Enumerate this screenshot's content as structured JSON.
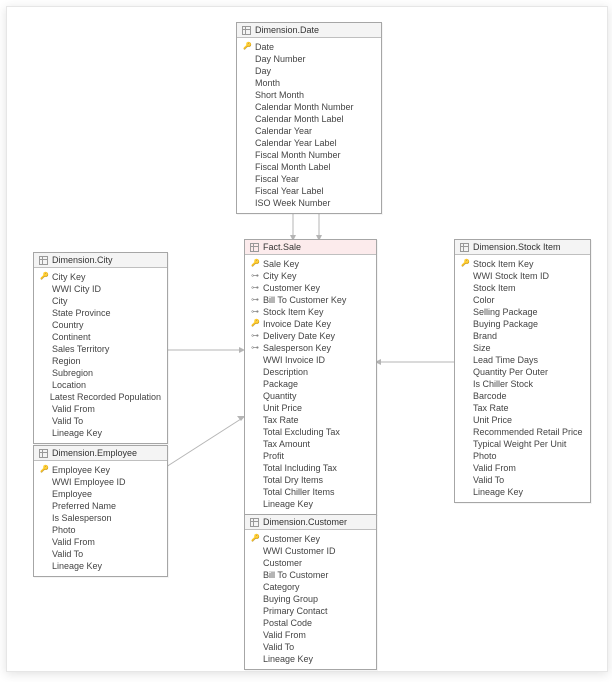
{
  "tables": {
    "date": {
      "title": "Dimension.Date",
      "columns": [
        {
          "name": "Date",
          "kind": "pk"
        },
        {
          "name": "Day Number",
          "kind": ""
        },
        {
          "name": "Day",
          "kind": ""
        },
        {
          "name": "Month",
          "kind": ""
        },
        {
          "name": "Short Month",
          "kind": ""
        },
        {
          "name": "Calendar Month Number",
          "kind": ""
        },
        {
          "name": "Calendar Month Label",
          "kind": ""
        },
        {
          "name": "Calendar Year",
          "kind": ""
        },
        {
          "name": "Calendar Year Label",
          "kind": ""
        },
        {
          "name": "Fiscal Month Number",
          "kind": ""
        },
        {
          "name": "Fiscal Month Label",
          "kind": ""
        },
        {
          "name": "Fiscal Year",
          "kind": ""
        },
        {
          "name": "Fiscal Year Label",
          "kind": ""
        },
        {
          "name": "ISO Week Number",
          "kind": ""
        }
      ]
    },
    "city": {
      "title": "Dimension.City",
      "columns": [
        {
          "name": "City Key",
          "kind": "pk"
        },
        {
          "name": "WWI City ID",
          "kind": ""
        },
        {
          "name": "City",
          "kind": ""
        },
        {
          "name": "State Province",
          "kind": ""
        },
        {
          "name": "Country",
          "kind": ""
        },
        {
          "name": "Continent",
          "kind": ""
        },
        {
          "name": "Sales Territory",
          "kind": ""
        },
        {
          "name": "Region",
          "kind": ""
        },
        {
          "name": "Subregion",
          "kind": ""
        },
        {
          "name": "Location",
          "kind": ""
        },
        {
          "name": "Latest Recorded Population",
          "kind": ""
        },
        {
          "name": "Valid From",
          "kind": ""
        },
        {
          "name": "Valid To",
          "kind": ""
        },
        {
          "name": "Lineage Key",
          "kind": ""
        }
      ]
    },
    "fact": {
      "title": "Fact.Sale",
      "columns": [
        {
          "name": "Sale Key",
          "kind": "pk"
        },
        {
          "name": "City Key",
          "kind": "fk"
        },
        {
          "name": "Customer Key",
          "kind": "fk"
        },
        {
          "name": "Bill To Customer Key",
          "kind": "fk"
        },
        {
          "name": "Stock Item Key",
          "kind": "fk"
        },
        {
          "name": "Invoice Date Key",
          "kind": "pk"
        },
        {
          "name": "Delivery Date Key",
          "kind": "fk"
        },
        {
          "name": "Salesperson Key",
          "kind": "fk"
        },
        {
          "name": "WWI Invoice ID",
          "kind": ""
        },
        {
          "name": "Description",
          "kind": ""
        },
        {
          "name": "Package",
          "kind": ""
        },
        {
          "name": "Quantity",
          "kind": ""
        },
        {
          "name": "Unit Price",
          "kind": ""
        },
        {
          "name": "Tax Rate",
          "kind": ""
        },
        {
          "name": "Total Excluding Tax",
          "kind": ""
        },
        {
          "name": "Tax Amount",
          "kind": ""
        },
        {
          "name": "Profit",
          "kind": ""
        },
        {
          "name": "Total Including Tax",
          "kind": ""
        },
        {
          "name": "Total Dry Items",
          "kind": ""
        },
        {
          "name": "Total Chiller Items",
          "kind": ""
        },
        {
          "name": "Lineage Key",
          "kind": ""
        }
      ]
    },
    "stock": {
      "title": "Dimension.Stock Item",
      "columns": [
        {
          "name": "Stock Item Key",
          "kind": "pk"
        },
        {
          "name": "WWI Stock Item ID",
          "kind": ""
        },
        {
          "name": "Stock Item",
          "kind": ""
        },
        {
          "name": "Color",
          "kind": ""
        },
        {
          "name": "Selling Package",
          "kind": ""
        },
        {
          "name": "Buying Package",
          "kind": ""
        },
        {
          "name": "Brand",
          "kind": ""
        },
        {
          "name": "Size",
          "kind": ""
        },
        {
          "name": "Lead Time Days",
          "kind": ""
        },
        {
          "name": "Quantity Per Outer",
          "kind": ""
        },
        {
          "name": "Is Chiller Stock",
          "kind": ""
        },
        {
          "name": "Barcode",
          "kind": ""
        },
        {
          "name": "Tax Rate",
          "kind": ""
        },
        {
          "name": "Unit Price",
          "kind": ""
        },
        {
          "name": "Recommended Retail Price",
          "kind": ""
        },
        {
          "name": "Typical Weight Per Unit",
          "kind": ""
        },
        {
          "name": "Photo",
          "kind": ""
        },
        {
          "name": "Valid From",
          "kind": ""
        },
        {
          "name": "Valid To",
          "kind": ""
        },
        {
          "name": "Lineage Key",
          "kind": ""
        }
      ]
    },
    "employee": {
      "title": "Dimension.Employee",
      "columns": [
        {
          "name": "Employee Key",
          "kind": "pk"
        },
        {
          "name": "WWI Employee ID",
          "kind": ""
        },
        {
          "name": "Employee",
          "kind": ""
        },
        {
          "name": "Preferred Name",
          "kind": ""
        },
        {
          "name": "Is Salesperson",
          "kind": ""
        },
        {
          "name": "Photo",
          "kind": ""
        },
        {
          "name": "Valid From",
          "kind": ""
        },
        {
          "name": "Valid To",
          "kind": ""
        },
        {
          "name": "Lineage Key",
          "kind": ""
        }
      ]
    },
    "customer": {
      "title": "Dimension.Customer",
      "columns": [
        {
          "name": "Customer Key",
          "kind": "pk"
        },
        {
          "name": "WWI Customer ID",
          "kind": ""
        },
        {
          "name": "Customer",
          "kind": ""
        },
        {
          "name": "Bill To Customer",
          "kind": ""
        },
        {
          "name": "Category",
          "kind": ""
        },
        {
          "name": "Buying Group",
          "kind": ""
        },
        {
          "name": "Primary Contact",
          "kind": ""
        },
        {
          "name": "Postal Code",
          "kind": ""
        },
        {
          "name": "Valid From",
          "kind": ""
        },
        {
          "name": "Valid To",
          "kind": ""
        },
        {
          "name": "Lineage Key",
          "kind": ""
        }
      ]
    }
  }
}
